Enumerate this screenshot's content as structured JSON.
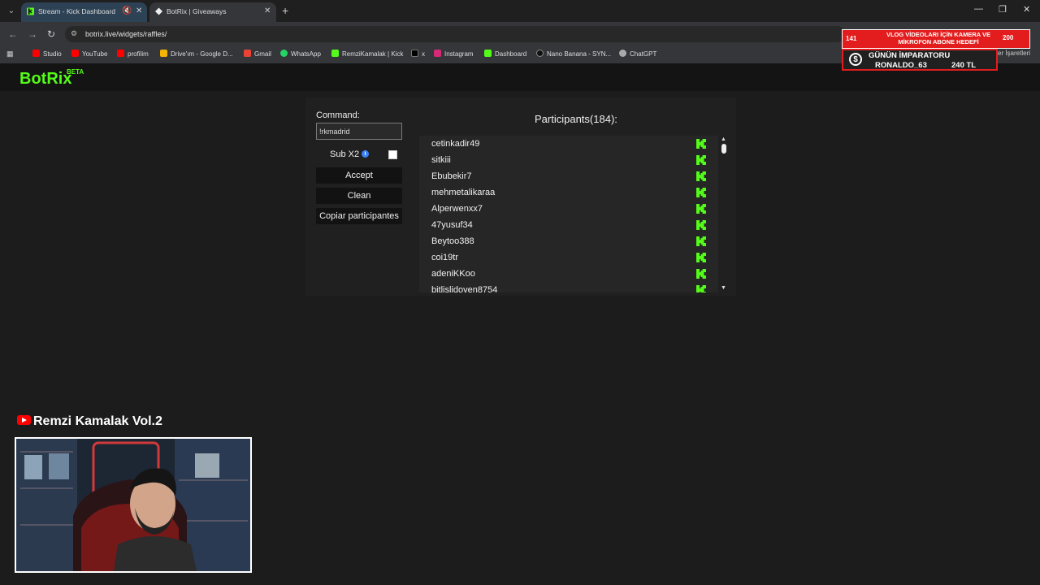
{
  "browser": {
    "tabs": [
      {
        "title": "Stream - Kick Dashboard",
        "active": false
      },
      {
        "title": "BotRix | Giveaways",
        "active": true
      }
    ],
    "url": "botrix.live/widgets/raffles/",
    "bookmarks": [
      {
        "label": "Studio",
        "icon": "youtube-icon"
      },
      {
        "label": "YouTube",
        "icon": "youtube-icon"
      },
      {
        "label": "profilim",
        "icon": "youtube-icon"
      },
      {
        "label": "Drive'ım - Google D...",
        "icon": "drive-icon"
      },
      {
        "label": "Gmail",
        "icon": "gmail-icon"
      },
      {
        "label": "WhatsApp",
        "icon": "whatsapp-icon"
      },
      {
        "label": "RemziKamalak | Kick",
        "icon": "kick-icon"
      },
      {
        "label": "x",
        "icon": "x-icon"
      },
      {
        "label": "Instagram",
        "icon": "instagram-icon"
      },
      {
        "label": "Dashboard",
        "icon": "kick-icon"
      },
      {
        "label": "Nano Banana - SYN...",
        "icon": "syn-icon"
      },
      {
        "label": "ChatGPT",
        "icon": "chatgpt-icon"
      }
    ],
    "bookmarks_tail": "er İşaretleri"
  },
  "app": {
    "logo": "BotRix",
    "badge": "BETA"
  },
  "raffle": {
    "command_label": "Command:",
    "command_value": "!rkmadrid",
    "sub_label": "Sub X2",
    "sub_checked": false,
    "accept_label": "Accept",
    "clean_label": "Clean",
    "copy_label": "Copiar participantes",
    "participants_title": "Participants(184):",
    "participants": [
      "cetinkadir49",
      "sitkiii",
      "Ebubekir7",
      "mehmetalikaraa",
      "Alperwenxx7",
      "47yusuf34",
      "Beytoo388",
      "coi19tr",
      "adeniKKoo",
      "bitlislidoven8754"
    ],
    "kick_color": "#53fc18"
  },
  "overlay": {
    "goal_count": "141",
    "goal_text": "VLOG VİDEOLARI İÇİN KAMERA VE MİKROFON ABONE HEDEFİ",
    "goal_target": "200",
    "top_title": "GÜNÜN İMPARATORU",
    "top_user": "RONALDO_63",
    "top_amount": "240 TL"
  },
  "stream": {
    "channel_name": "Remzi Kamalak Vol.2"
  }
}
